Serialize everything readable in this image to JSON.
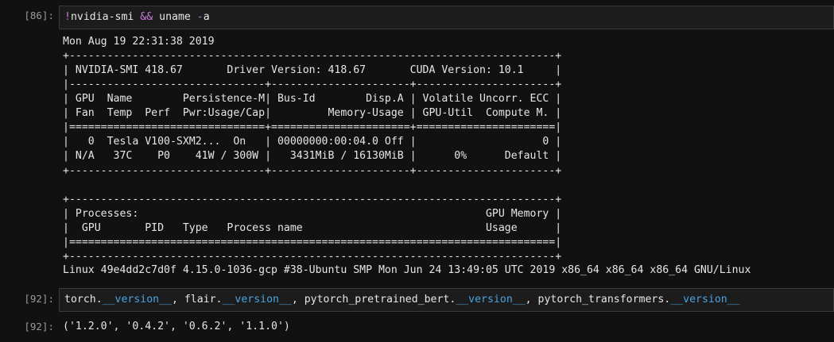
{
  "cells": [
    {
      "prompt": "[86]:",
      "input": {
        "bang": "!",
        "cmd1": "nvidia-smi ",
        "amp": "&&",
        "cmd2": " uname ",
        "flag_dash": "-",
        "flag": "a"
      },
      "output": {
        "date": "Mon Aug 19 22:31:38 2019",
        "smi_table": "+-----------------------------------------------------------------------------+\n| NVIDIA-SMI 418.67       Driver Version: 418.67       CUDA Version: 10.1     |\n|-------------------------------+----------------------+----------------------+\n| GPU  Name        Persistence-M| Bus-Id        Disp.A | Volatile Uncorr. ECC |\n| Fan  Temp  Perf  Pwr:Usage/Cap|         Memory-Usage | GPU-Util  Compute M. |\n|===============================+======================+======================|\n|   0  Tesla V100-SXM2...  On   | 00000000:00:04.0 Off |                    0 |\n| N/A   37C    P0    41W / 300W |   3431MiB / 16130MiB |      0%      Default |\n+-------------------------------+----------------------+----------------------+\n\n+-----------------------------------------------------------------------------+\n| Processes:                                                       GPU Memory |\n|  GPU       PID   Type   Process name                             Usage      |\n|=============================================================================|\n+-----------------------------------------------------------------------------+",
        "uname": "Linux 49e4dd2c7d0f 4.15.0-1036-gcp #38-Ubuntu SMP Mon Jun 24 13:49:05 UTC 2019 x86_64 x86_64 x86_64 GNU/Linux"
      }
    },
    {
      "prompt": "[92]:",
      "input": {
        "t1": "torch.",
        "d1": "__version__",
        "t2": ", flair.",
        "d2": "__version__",
        "t3": ", pytorch_pretrained_bert.",
        "d3": "__version__",
        "t4": ", pytorch_transformers.",
        "d4": "__version__"
      },
      "out_prompt": "[92]:",
      "output": "('1.2.0', '0.4.2', '0.6.2', '1.1.0')"
    }
  ],
  "colors": {
    "background": "#111111",
    "input_bg": "#1c1c1c",
    "operator": "#c678dd",
    "dunder": "#4aa3e0",
    "prompt": "#9a9a9a"
  }
}
